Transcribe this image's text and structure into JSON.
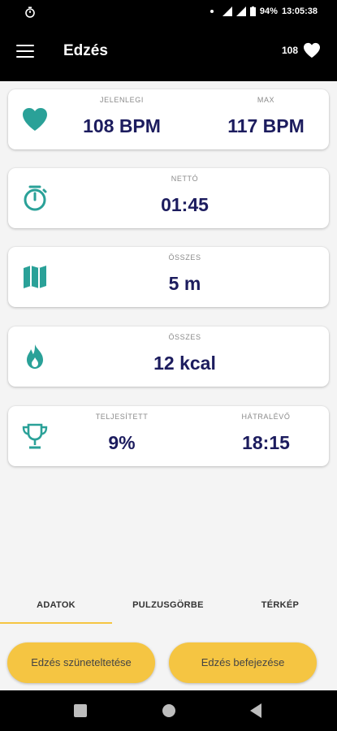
{
  "status_bar": {
    "battery": "94%",
    "time": "13:05:38"
  },
  "toolbar": {
    "title": "Edzés",
    "heart_rate": "108"
  },
  "cards": {
    "heart": {
      "label_current": "JELENLEGI",
      "value_current": "108 BPM",
      "label_max": "MAX",
      "value_max": "117 BPM"
    },
    "timer": {
      "label": "NETTÓ",
      "value": "01:45"
    },
    "distance": {
      "label": "ÖSSZES",
      "value": "5 m"
    },
    "calories": {
      "label": "ÖSSZES",
      "value": "12 kcal"
    },
    "progress": {
      "label_done": "TELJESÍTETT",
      "value_done": "9%",
      "label_remaining": "HÁTRALÉVŐ",
      "value_remaining": "18:15"
    }
  },
  "tabs": [
    {
      "label": "ADATOK",
      "active": true
    },
    {
      "label": "PULZUSGÖRBE",
      "active": false
    },
    {
      "label": "TÉRKÉP",
      "active": false
    }
  ],
  "buttons": {
    "pause": "Edzés szüneteltetése",
    "finish": "Edzés befejezése"
  },
  "colors": {
    "accent": "#f5c542",
    "icon": "#2aa198",
    "value_text": "#1c1c5e"
  }
}
